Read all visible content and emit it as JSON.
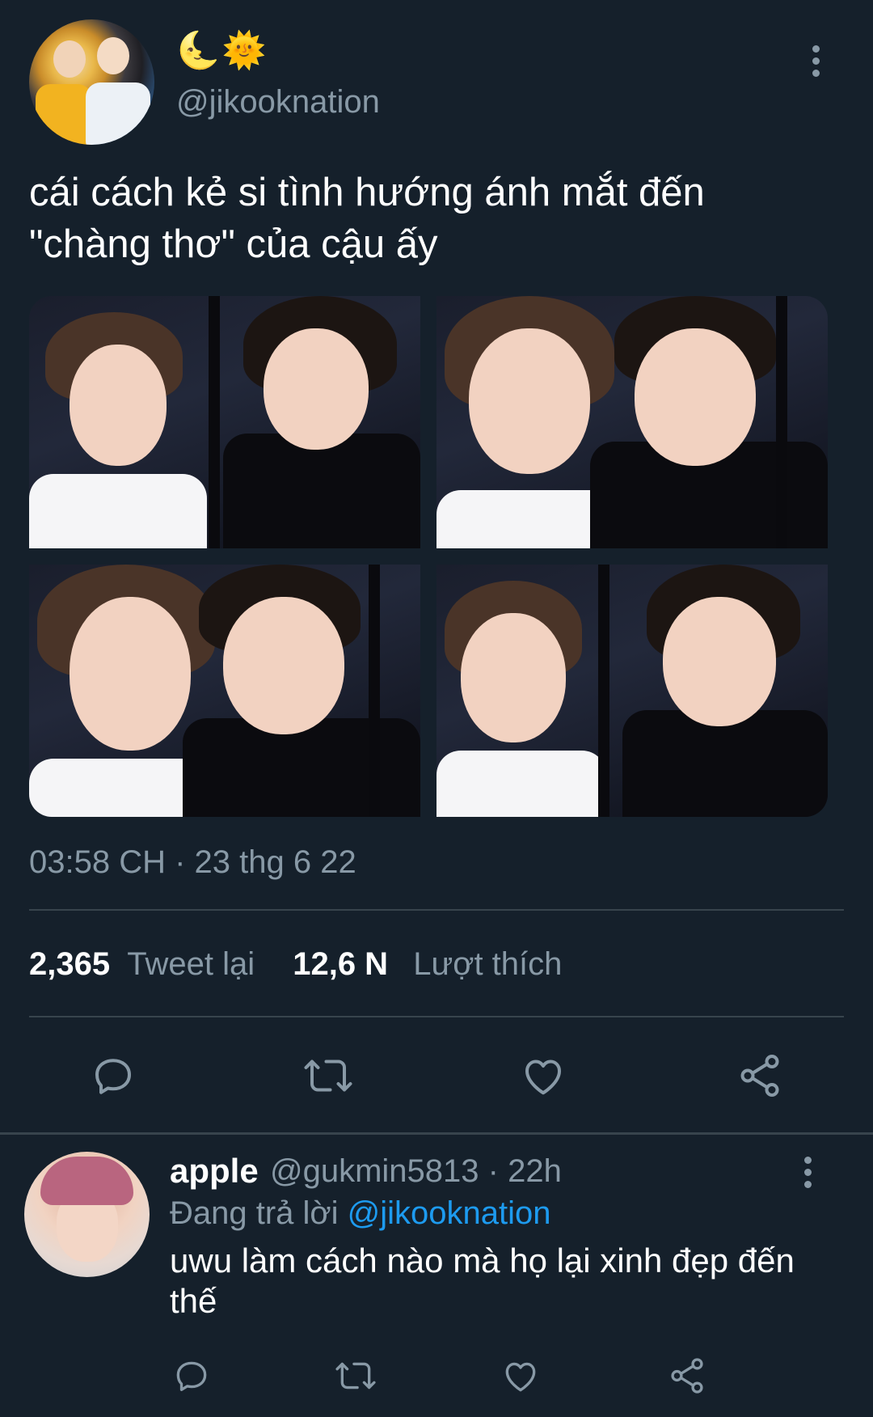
{
  "tweet": {
    "display_name_emoji": "🌜🌞",
    "handle": "@jikooknation",
    "text": "cái cách kẻ si tình hướng ánh mắt đến \"chàng thơ\" của cậu ấy",
    "timestamp": "03:58 CH · 23 thg 6 22",
    "retweets_count": "2,365",
    "retweets_label": "Tweet lại",
    "likes_count": "12,6 N",
    "likes_label": "Lượt thích",
    "photo_count": 4
  },
  "actions": {
    "icons": [
      "reply-icon",
      "retweet-icon",
      "like-icon",
      "share-icon"
    ]
  },
  "reply": {
    "name": "apple",
    "handle_time": "@gukmin5813 · 22h",
    "replying_label": "Đang trả lời",
    "replying_to": "@jikooknation",
    "text": "uwu làm cách nào mà họ lại xinh đẹp đến thế"
  },
  "colors": {
    "background": "#15202b",
    "text_primary": "#ffffff",
    "text_secondary": "#8899a6",
    "accent": "#1d9bf0",
    "divider": "#38444d"
  }
}
